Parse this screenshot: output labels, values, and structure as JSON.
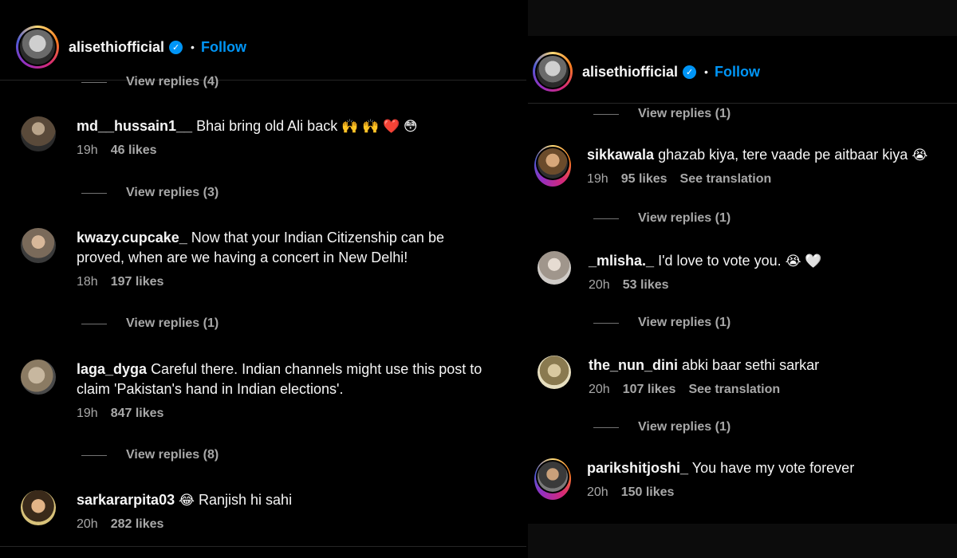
{
  "left": {
    "header": {
      "username": "alisethiofficial",
      "dot": "•",
      "follow": "Follow"
    },
    "view_replies_top": "View replies (4)",
    "comments": [
      {
        "user": "md__hussain1__",
        "text": "Bhai bring old Ali back",
        "emoji": "🙌 🙌 ❤️ 😳",
        "time": "19h",
        "likes": "46 likes",
        "replies": "View replies (3)"
      },
      {
        "user": "kwazy.cupcake_",
        "text": "Now that your Indian Citizenship can be proved, when are we having a concert in New Delhi!",
        "emoji": "",
        "time": "18h",
        "likes": "197 likes",
        "replies": "View replies (1)"
      },
      {
        "user": "laga_dyga",
        "text": "Careful there. Indian channels might use this post to claim 'Pakistan's hand in Indian elections'.",
        "emoji": "",
        "time": "19h",
        "likes": "847 likes",
        "replies": "View replies (8)"
      },
      {
        "user": "sarkararpita03",
        "text": "Ranjish hi sahi",
        "emoji": "😂",
        "time": "20h",
        "likes": "282 likes",
        "replies": ""
      }
    ]
  },
  "right": {
    "more": "••",
    "header": {
      "username": "alisethiofficial",
      "dot": "•",
      "follow": "Follow"
    },
    "view_replies_top": "View replies (1)",
    "comments": [
      {
        "user": "sikkawala",
        "text": "ghazab kiya, tere vaade pe aitbaar kiya",
        "emoji": "😭",
        "time": "19h",
        "likes": "95 likes",
        "translation": "See translation",
        "replies": "View replies (1)"
      },
      {
        "user": "_mlisha._",
        "text": "I'd love to vote you.",
        "emoji": "😭 🤍",
        "time": "20h",
        "likes": "53 likes",
        "translation": "",
        "replies": "View replies (1)"
      },
      {
        "user": "the_nun_dini",
        "text": "abki baar sethi sarkar",
        "emoji": "",
        "time": "20h",
        "likes": "107 likes",
        "translation": "See translation",
        "replies": "View replies (1)"
      },
      {
        "user": "parikshitjoshi_",
        "text": "You have my vote forever",
        "emoji": "",
        "time": "20h",
        "likes": "150 likes",
        "translation": "",
        "replies": ""
      }
    ]
  },
  "colors": {
    "follow": "#0095f6",
    "muted": "#a8a8a8",
    "background": "#000000",
    "verified": "#0095f6"
  }
}
